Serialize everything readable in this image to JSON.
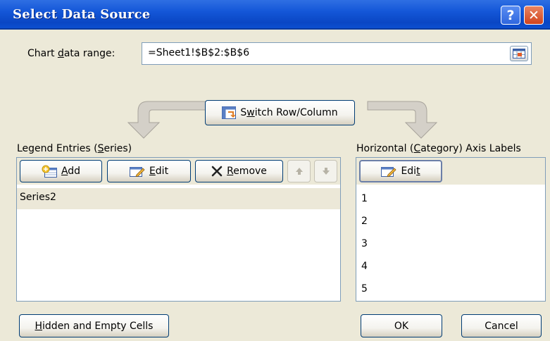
{
  "window": {
    "title": "Select Data Source",
    "help_label": "?",
    "close_label": "✕"
  },
  "data_range": {
    "label_pre": "Chart ",
    "label_accel": "d",
    "label_post": "ata range:",
    "value": "=Sheet1!$B$2:$B$6"
  },
  "switch_button": {
    "label_pre": "S",
    "label_accel": "w",
    "label_post": "itch Row/Column"
  },
  "legend": {
    "heading_pre": "Legend Entries (",
    "heading_accel": "S",
    "heading_post": "eries)",
    "add_accel": "A",
    "add_rest": "dd",
    "edit_accel": "E",
    "edit_rest": "dit",
    "remove_accel": "R",
    "remove_rest": "emove",
    "series": [
      "Series2"
    ]
  },
  "category": {
    "heading_pre": "Horizontal (",
    "heading_accel": "C",
    "heading_post": "ategory) Axis Labels",
    "edit_pre": "Edi",
    "edit_accel": "t",
    "labels": [
      "1",
      "2",
      "3",
      "4",
      "5"
    ]
  },
  "footer": {
    "hidden_accel": "H",
    "hidden_rest": "idden and Empty Cells",
    "ok_label": "OK",
    "cancel_label": "Cancel"
  }
}
